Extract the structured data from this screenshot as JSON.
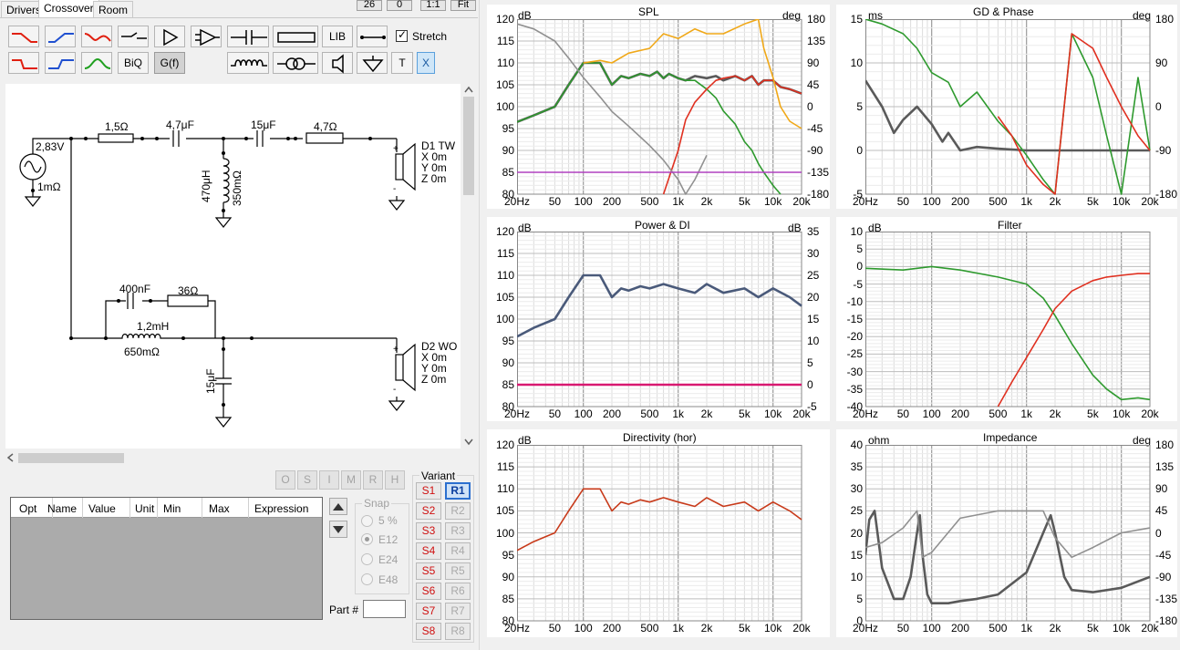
{
  "tabs": [
    {
      "label": "Drivers"
    },
    {
      "label": "Crossover"
    },
    {
      "label": "Room"
    }
  ],
  "top_buttons": {
    "b1": "26",
    "b2": "0",
    "b3": "1:1",
    "b4": "Fit"
  },
  "toolbar": {
    "lib": "LIB",
    "stretch": "Stretch",
    "biq": "BiQ",
    "gf": "G(f)",
    "t": "T",
    "x": "X"
  },
  "schematic": {
    "source_voltage": "2,83V",
    "source_impedance": "1mΩ",
    "r1": "1,5Ω",
    "c1": "4,7μF",
    "c2": "15μF",
    "r2": "4,7Ω",
    "l1": "470μH",
    "l1_r": "350mΩ",
    "d1": {
      "name": "D1 TW",
      "x": "X 0m",
      "y": "Y 0m",
      "z": "Z 0m"
    },
    "c3": "400nF",
    "r3": "36Ω",
    "l2": "1,2mH",
    "l2_r": "650mΩ",
    "c4": "15μF",
    "d2": {
      "name": "D2 WO",
      "x": "X 0m",
      "y": "Y 0m",
      "z": "Z 0m"
    }
  },
  "opt_buttons": [
    "O",
    "S",
    "I",
    "M",
    "R",
    "H"
  ],
  "opt_table": {
    "columns": [
      "Opt",
      "Name",
      "Value",
      "Unit",
      "Min",
      "Max",
      "Expression"
    ]
  },
  "snap": {
    "label": "Snap",
    "options": [
      "5 %",
      "E12",
      "E24",
      "E48"
    ],
    "selected": "E12"
  },
  "part_label": "Part #",
  "variant": {
    "label": "Variant",
    "s": [
      "S1",
      "S2",
      "S3",
      "S4",
      "S5",
      "S6",
      "S7",
      "S8"
    ],
    "r": [
      "R1",
      "R2",
      "R3",
      "R4",
      "R5",
      "R6",
      "R7",
      "R8"
    ],
    "selected": "R1"
  },
  "freq_ticks": [
    "20Hz",
    "50",
    "100",
    "200",
    "500",
    "1k",
    "2k",
    "5k",
    "10k",
    "20k"
  ],
  "colors": {
    "green": "#2e9a2e",
    "red": "#e03020",
    "gray": "#5a5a5a",
    "orange": "#f0a818",
    "magenta": "#b040c0",
    "pink": "#d81870",
    "blue_gray": "#4a5a7a",
    "rust": "#c83a1a"
  },
  "charts": {
    "spl": {
      "title": "SPL",
      "left_unit": "dB",
      "right_unit": "deg",
      "left_ticks": [
        "120",
        "115",
        "110",
        "105",
        "100",
        "95",
        "90",
        "85",
        "80"
      ],
      "right_ticks": [
        "180",
        "135",
        "90",
        "45",
        "0",
        "-45",
        "-90",
        "-135",
        "-180"
      ]
    },
    "gd": {
      "title": "GD & Phase",
      "left_unit": "ms",
      "right_unit": "deg",
      "left_ticks": [
        "15",
        "10",
        "5",
        "0",
        "-5"
      ],
      "right_ticks": [
        "180",
        "90",
        "0",
        "-90",
        "-180"
      ]
    },
    "power": {
      "title": "Power & DI",
      "left_unit": "dB",
      "right_unit": "dB",
      "left_ticks": [
        "120",
        "115",
        "110",
        "105",
        "100",
        "95",
        "90",
        "85",
        "80"
      ],
      "right_ticks": [
        "35",
        "30",
        "25",
        "20",
        "15",
        "10",
        "5",
        "0",
        "-5"
      ]
    },
    "filter": {
      "title": "Filter",
      "left_unit": "dB",
      "left_ticks": [
        "10",
        "5",
        "0",
        "-5",
        "-10",
        "-15",
        "-20",
        "-25",
        "-30",
        "-35",
        "-40"
      ]
    },
    "directivity": {
      "title": "Directivity (hor)",
      "left_unit": "dB",
      "left_ticks": [
        "120",
        "115",
        "110",
        "105",
        "100",
        "95",
        "90",
        "85",
        "80"
      ]
    },
    "impedance": {
      "title": "Impedance",
      "left_unit": "ohm",
      "right_unit": "deg",
      "left_ticks": [
        "40",
        "35",
        "30",
        "25",
        "20",
        "15",
        "10",
        "5",
        "0"
      ],
      "right_ticks": [
        "180",
        "135",
        "90",
        "45",
        "0",
        "-45",
        "-90",
        "-135",
        "-180"
      ]
    }
  },
  "chart_data": [
    {
      "type": "line",
      "title": "SPL",
      "x_scale": "log",
      "xlim": [
        20,
        20000
      ],
      "ylabel": "dB",
      "ylim": [
        80,
        120
      ],
      "y2label": "deg",
      "y2lim": [
        -180,
        180
      ],
      "series": [
        {
          "color": "#5a5a5a",
          "axis": "y",
          "x": [
            20,
            30,
            50,
            70,
            100,
            150,
            200,
            250,
            300,
            400,
            500,
            600,
            700,
            800,
            1000,
            1200,
            1500,
            2000,
            2500,
            3000,
            4000,
            5000,
            6000,
            7000,
            8000,
            10000,
            12000,
            15000,
            20000
          ],
          "y": [
            96.5,
            98,
            100,
            105,
            110,
            110,
            105,
            107,
            106.5,
            107.5,
            107,
            108,
            106.5,
            107.5,
            106.5,
            106,
            107,
            106.5,
            107,
            106,
            107,
            106,
            107,
            105,
            106,
            106,
            104.5,
            104,
            103
          ]
        },
        {
          "color": "#2e9a2e",
          "axis": "y",
          "x": [
            20,
            30,
            50,
            70,
            100,
            150,
            200,
            250,
            300,
            400,
            500,
            600,
            700,
            800,
            1000,
            1200,
            1500,
            2000,
            2500,
            3000,
            4000,
            5000,
            6000,
            7000,
            8000,
            10000,
            12000
          ],
          "y": [
            96.5,
            98,
            100,
            105,
            110,
            110,
            105,
            107,
            106.5,
            107.5,
            107,
            108,
            106.5,
            107.5,
            106.5,
            106,
            106,
            104,
            102,
            99,
            96,
            92,
            90,
            87,
            85,
            82,
            80
          ]
        },
        {
          "color": "#e03020",
          "axis": "y",
          "x": [
            700,
            1000,
            1200,
            1500,
            2000,
            2500,
            3000,
            4000,
            5000,
            6000,
            7000,
            8000,
            10000,
            12000,
            15000,
            20000
          ],
          "y": [
            80,
            90,
            97,
            101,
            104,
            106,
            106.5,
            107,
            106,
            107,
            105,
            106,
            106,
            104.5,
            104,
            103
          ]
        },
        {
          "color": "#f0a818",
          "axis": "y2",
          "x": [
            100,
            150,
            200,
            300,
            500,
            700,
            1000,
            1500,
            2000,
            3000,
            5000,
            7000,
            8000,
            10000,
            12000,
            15000,
            20000
          ],
          "y": [
            90,
            95,
            90,
            110,
            120,
            150,
            140,
            160,
            150,
            150,
            170,
            180,
            120,
            60,
            0,
            -30,
            -45
          ]
        },
        {
          "color": "#909090",
          "axis": "y2",
          "x": [
            20,
            30,
            50,
            70,
            100,
            150,
            200,
            300,
            500,
            700,
            1000,
            1200,
            1500,
            2000
          ],
          "y": [
            170,
            160,
            135,
            100,
            60,
            20,
            -10,
            -40,
            -80,
            -110,
            -150,
            -180,
            -150,
            -100
          ]
        },
        {
          "color": "#b040c0",
          "axis": "y",
          "x": [
            20,
            20000
          ],
          "y": [
            85,
            85
          ]
        }
      ]
    },
    {
      "type": "line",
      "title": "GD & Phase",
      "x_scale": "log",
      "xlim": [
        20,
        20000
      ],
      "ylabel": "ms",
      "ylim": [
        -5,
        15
      ],
      "y2label": "deg",
      "y2lim": [
        -180,
        180
      ],
      "series": [
        {
          "color": "#5a5a5a",
          "axis": "y",
          "x": [
            20,
            30,
            40,
            50,
            70,
            100,
            130,
            150,
            200,
            300,
            500,
            1000,
            2000,
            5000,
            10000,
            20000
          ],
          "y": [
            8,
            5,
            2,
            3.5,
            5,
            3,
            1,
            2,
            0,
            0.4,
            0.2,
            0,
            0,
            0,
            0,
            0
          ]
        },
        {
          "color": "#2e9a2e",
          "axis": "y2",
          "x": [
            20,
            30,
            50,
            70,
            100,
            150,
            200,
            300,
            500,
            700,
            1000,
            1500,
            2000,
            3000,
            5000,
            7000,
            10000,
            15000,
            20000
          ],
          "y": [
            180,
            170,
            150,
            120,
            70,
            50,
            0,
            30,
            -30,
            -60,
            -100,
            -150,
            -180,
            150,
            60,
            -60,
            -180,
            60,
            -90
          ]
        },
        {
          "color": "#e03020",
          "axis": "y2",
          "x": [
            500,
            700,
            1000,
            1500,
            2000,
            3000,
            5000,
            7000,
            10000,
            15000,
            20000
          ],
          "y": [
            -20,
            -60,
            -120,
            -160,
            -180,
            150,
            120,
            60,
            0,
            -60,
            -90
          ]
        }
      ]
    },
    {
      "type": "line",
      "title": "Power & DI",
      "x_scale": "log",
      "xlim": [
        20,
        20000
      ],
      "ylabel": "dB",
      "ylim": [
        80,
        120
      ],
      "y2label": "dB",
      "y2lim": [
        -5,
        35
      ],
      "series": [
        {
          "color": "#4a5a7a",
          "axis": "y",
          "x": [
            20,
            30,
            50,
            70,
            100,
            150,
            200,
            250,
            300,
            400,
            500,
            700,
            1000,
            1500,
            2000,
            3000,
            5000,
            7000,
            10000,
            15000,
            20000
          ],
          "y": [
            96,
            98,
            100,
            105,
            110,
            110,
            105,
            107,
            106.5,
            107.5,
            107,
            108,
            107,
            106,
            108,
            106,
            107,
            105,
            107,
            105,
            103
          ]
        },
        {
          "color": "#d81870",
          "axis": "y2",
          "x": [
            20,
            20000
          ],
          "y": [
            0,
            0
          ]
        }
      ]
    },
    {
      "type": "line",
      "title": "Filter",
      "x_scale": "log",
      "xlim": [
        20,
        20000
      ],
      "ylabel": "dB",
      "ylim": [
        -40,
        10
      ],
      "series": [
        {
          "color": "#2e9a2e",
          "x": [
            20,
            50,
            100,
            200,
            500,
            1000,
            1500,
            2000,
            3000,
            5000,
            7000,
            10000,
            15000,
            20000
          ],
          "y": [
            -0.5,
            -1,
            0,
            -1,
            -3,
            -5,
            -9,
            -14,
            -22,
            -31,
            -35,
            -38,
            -37.5,
            -38
          ]
        },
        {
          "color": "#e03020",
          "x": [
            500,
            700,
            1000,
            1500,
            2000,
            3000,
            5000,
            7000,
            10000,
            15000,
            20000
          ],
          "y": [
            -40,
            -33,
            -26,
            -18,
            -12,
            -7,
            -4,
            -3,
            -2.5,
            -2,
            -2
          ]
        }
      ]
    },
    {
      "type": "line",
      "title": "Directivity (hor)",
      "x_scale": "log",
      "xlim": [
        20,
        20000
      ],
      "ylabel": "dB",
      "ylim": [
        80,
        120
      ],
      "series": [
        {
          "color": "#c83a1a",
          "x": [
            20,
            30,
            50,
            70,
            100,
            150,
            200,
            250,
            300,
            400,
            500,
            700,
            1000,
            1500,
            2000,
            3000,
            5000,
            7000,
            10000,
            15000,
            20000
          ],
          "y": [
            96,
            98,
            100,
            105,
            110,
            110,
            105,
            107,
            106.5,
            107.5,
            107,
            108,
            107,
            106,
            108,
            106,
            107,
            105,
            107,
            105,
            103
          ]
        }
      ]
    },
    {
      "type": "line",
      "title": "Impedance",
      "x_scale": "log",
      "xlim": [
        20,
        20000
      ],
      "ylabel": "ohm",
      "ylim": [
        0,
        40
      ],
      "y2label": "deg",
      "y2lim": [
        -180,
        180
      ],
      "series": [
        {
          "color": "#5a5a5a",
          "axis": "y",
          "x": [
            20,
            22,
            25,
            30,
            40,
            50,
            60,
            70,
            75,
            80,
            90,
            100,
            150,
            200,
            300,
            500,
            1000,
            1500,
            1800,
            2000,
            2500,
            3000,
            5000,
            10000,
            20000
          ],
          "y": [
            15,
            23,
            25,
            12,
            5,
            5,
            10,
            20,
            24,
            15,
            6,
            4,
            4,
            4.5,
            5,
            6,
            11,
            20,
            24,
            20,
            10,
            7,
            6.5,
            7.5,
            10
          ]
        },
        {
          "color": "#909090",
          "axis": "y2",
          "x": [
            20,
            30,
            50,
            70,
            80,
            100,
            200,
            500,
            1000,
            1500,
            2000,
            3000,
            5000,
            10000,
            20000
          ],
          "y": [
            -30,
            -20,
            10,
            45,
            -50,
            -40,
            30,
            45,
            45,
            45,
            -10,
            -50,
            -30,
            0,
            10
          ]
        }
      ]
    }
  ]
}
